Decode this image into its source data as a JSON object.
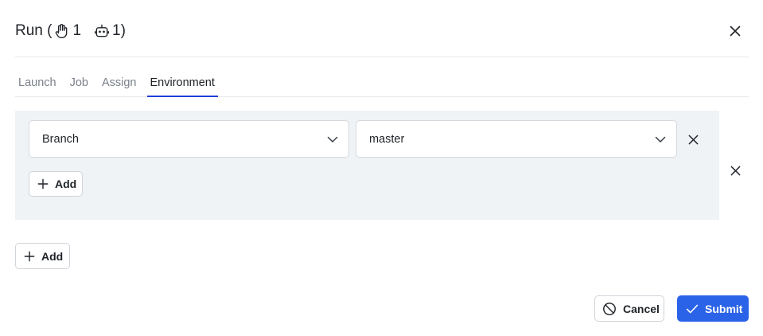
{
  "dialog": {
    "title_prefix": "Run (",
    "manual_count": "1",
    "bot_count": "1",
    "title_suffix": ")"
  },
  "tabs": [
    {
      "label": "Launch"
    },
    {
      "label": "Job"
    },
    {
      "label": "Assign"
    },
    {
      "label": "Environment",
      "active": true
    }
  ],
  "environment": {
    "key_value": "Branch",
    "value_value": "master",
    "add_label": "Add"
  },
  "outer_add_label": "Add",
  "footer": {
    "cancel_label": "Cancel",
    "submit_label": "Submit"
  },
  "colors": {
    "accent": "#2b63e8",
    "tab_underline": "#1f3ed6",
    "panel_bg": "#f0f3f6"
  },
  "icons": {
    "manual": "hand-icon",
    "bot": "robot-icon",
    "close": "close-icon",
    "chevron": "chevron-down-icon",
    "add": "plus-icon",
    "cancel": "ban-icon",
    "submit": "check-icon"
  }
}
